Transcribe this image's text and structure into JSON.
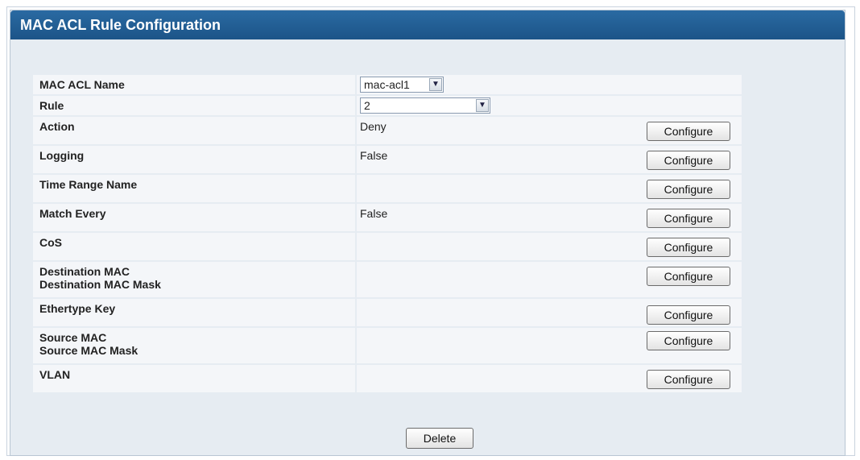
{
  "panel": {
    "title": "MAC ACL Rule Configuration"
  },
  "rows": {
    "mac_acl_name": {
      "label": "MAC ACL Name",
      "selected": "mac-acl1"
    },
    "rule": {
      "label": "Rule",
      "selected": "2"
    },
    "action": {
      "label": "Action",
      "value": "Deny",
      "button": "Configure"
    },
    "logging": {
      "label": "Logging",
      "value": "False",
      "button": "Configure"
    },
    "time_range": {
      "label": "Time Range Name",
      "value": "",
      "button": "Configure"
    },
    "match_every": {
      "label": "Match Every",
      "value": "False",
      "button": "Configure"
    },
    "cos": {
      "label": "CoS",
      "value": "",
      "button": "Configure"
    },
    "dest_mac": {
      "label1": "Destination MAC",
      "label2": "Destination MAC Mask",
      "value": "",
      "button": "Configure"
    },
    "ethertype": {
      "label": "Ethertype Key",
      "value": "",
      "button": "Configure"
    },
    "source_mac": {
      "label1": "Source MAC",
      "label2": "Source MAC Mask",
      "value": "",
      "button": "Configure"
    },
    "vlan": {
      "label": "VLAN",
      "value": "",
      "button": "Configure"
    }
  },
  "footer": {
    "delete_label": "Delete"
  },
  "icons": {
    "dropdown": "chevron-down-icon"
  }
}
